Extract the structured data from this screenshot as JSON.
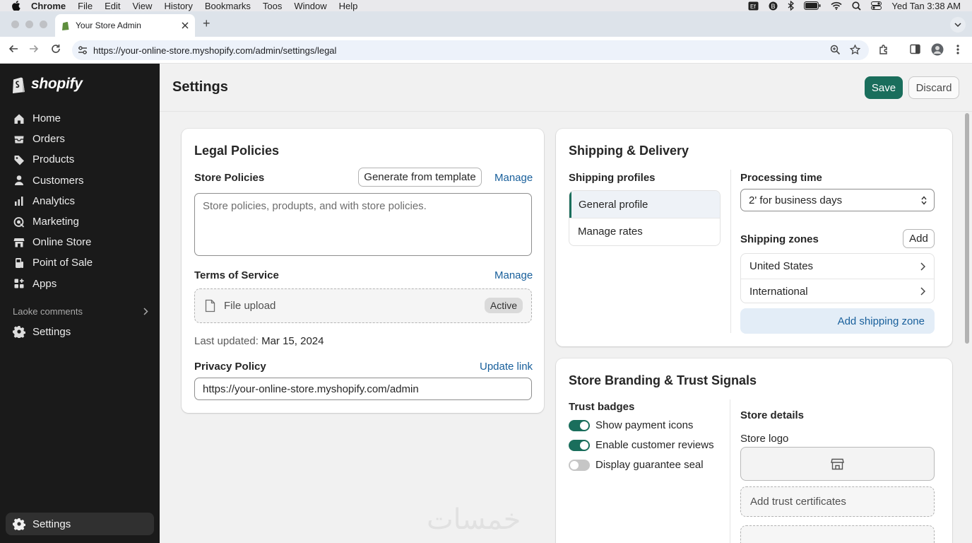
{
  "menubar": {
    "app": "Chrome",
    "items": [
      "File",
      "Edit",
      "View",
      "History",
      "Bookmarks",
      "Toos",
      "Window",
      "Help"
    ],
    "clock": "Yed Tan 3:38 AM"
  },
  "browser": {
    "tab_title": "Your Store Admin",
    "url": "https://your-online-store.myshopify.com/admin/settings/legal"
  },
  "sidebar": {
    "brand": "shopify",
    "nav": [
      {
        "label": "Home",
        "icon": "home-icon"
      },
      {
        "label": "Orders",
        "icon": "orders-icon"
      },
      {
        "label": "Products",
        "icon": "tag-icon"
      },
      {
        "label": "Customers",
        "icon": "person-icon"
      },
      {
        "label": "Analytics",
        "icon": "bar-chart-icon"
      },
      {
        "label": "Marketing",
        "icon": "target-icon"
      },
      {
        "label": "Online Store",
        "icon": "store-icon"
      },
      {
        "label": "Point of Sale",
        "icon": "pos-icon"
      },
      {
        "label": "Apps",
        "icon": "apps-icon"
      }
    ],
    "section_label": "Laoke comments",
    "settings_label": "Settings",
    "footer_settings_label": "Settings"
  },
  "header": {
    "title": "Settings",
    "save_label": "Save",
    "discard_label": "Discard"
  },
  "legal": {
    "title": "Legal Policies",
    "store_policies_label": "Store Policies",
    "generate_label": "Generate from template",
    "manage_label": "Manage",
    "policies_text": "Store policies, produpts, and with store policies.",
    "tos_label": "Terms of Service",
    "tos_manage_label": "Manage",
    "file_upload_label": "File upload",
    "active_badge": "Active",
    "last_updated_label": "Last updated:",
    "last_updated_value": "Mar 15, 2024",
    "privacy_label": "Privacy Policy",
    "update_link_label": "Update link",
    "privacy_url": "https://your-online-store.myshopify.com/admin"
  },
  "shipping": {
    "title": "Shipping & Delivery",
    "profiles_label": "Shipping profiles",
    "profiles": [
      "General profile",
      "Manage rates"
    ],
    "processing_label": "Processing time",
    "processing_value": "2' for business days",
    "zones_label": "Shipping zones",
    "add_label": "Add",
    "zones": [
      "United States",
      "International"
    ],
    "add_zone_label": "Add shipping zone"
  },
  "branding": {
    "title": "Store Branding & Trust Signals",
    "badges_label": "Trust badges",
    "toggles": [
      {
        "label": "Show payment icons",
        "on": true
      },
      {
        "label": "Enable customer reviews",
        "on": true
      },
      {
        "label": "Display guarantee seal",
        "on": false
      }
    ],
    "details_label": "Store details",
    "logo_label": "Store logo",
    "certificates_label": "Add trust certificates"
  },
  "colors": {
    "accent": "#1a6e5c",
    "link": "#185f9b",
    "sidebar": "#1a1a1a"
  }
}
